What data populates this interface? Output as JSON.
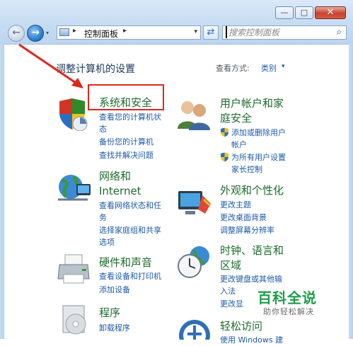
{
  "window": {
    "minimize_glyph": "—",
    "maximize_glyph": "□",
    "close_glyph": "✕"
  },
  "nav": {
    "back_glyph": "←",
    "forward_glyph": "→",
    "history_glyph": "▾"
  },
  "address_bar": {
    "separator": "▸",
    "crumb": "控制面板",
    "dropdown_glyph": "▾",
    "refresh_glyph": "⇄"
  },
  "search": {
    "placeholder": "搜索控制面板",
    "icon": "search-icon",
    "glyph": "⌕"
  },
  "header": {
    "title": "调整计算机的设置",
    "view_by_label": "查看方式:",
    "view_by_value": "类别",
    "view_by_arrow": "▾"
  },
  "categories": {
    "system_security": {
      "title": "系统和安全",
      "links": [
        "查看您的计算机状",
        "态",
        "备份您的计算机",
        "查找并解决问题"
      ]
    },
    "network": {
      "title_line1": "网络和",
      "title_line2": "Internet",
      "links": [
        "查看网络状态和任",
        "务",
        "选择家庭组和共享",
        "选项"
      ]
    },
    "hardware": {
      "title": "硬件和声音",
      "links": [
        "查看设备和打印机",
        "添加设备"
      ]
    },
    "programs": {
      "title": "程序",
      "links": [
        "卸载程序"
      ]
    },
    "user_accounts": {
      "title_line1": "用户帐户和家",
      "title_line2": "庭安全",
      "links": [
        "添加或删除用户",
        "帐户",
        "为所有用户设置",
        "家长控制"
      ]
    },
    "appearance": {
      "title": "外观和个性化",
      "links": [
        "更改主题",
        "更改桌面背景",
        "调整屏幕分辨率"
      ]
    },
    "clock": {
      "title_line1": "时钟、语言和",
      "title_line2": "区域",
      "links": [
        "更改键盘或其他输",
        "入法",
        "更改显"
      ]
    },
    "access": {
      "title": "轻松访问",
      "links": [
        "使用 Windows 建"
      ]
    }
  },
  "watermark": {
    "title": "百科全说",
    "subtitle": "助你轻松解决"
  },
  "colors": {
    "annotation": "#e0261b",
    "category_title": "#1e6b2c",
    "link": "#1e5aa8"
  }
}
